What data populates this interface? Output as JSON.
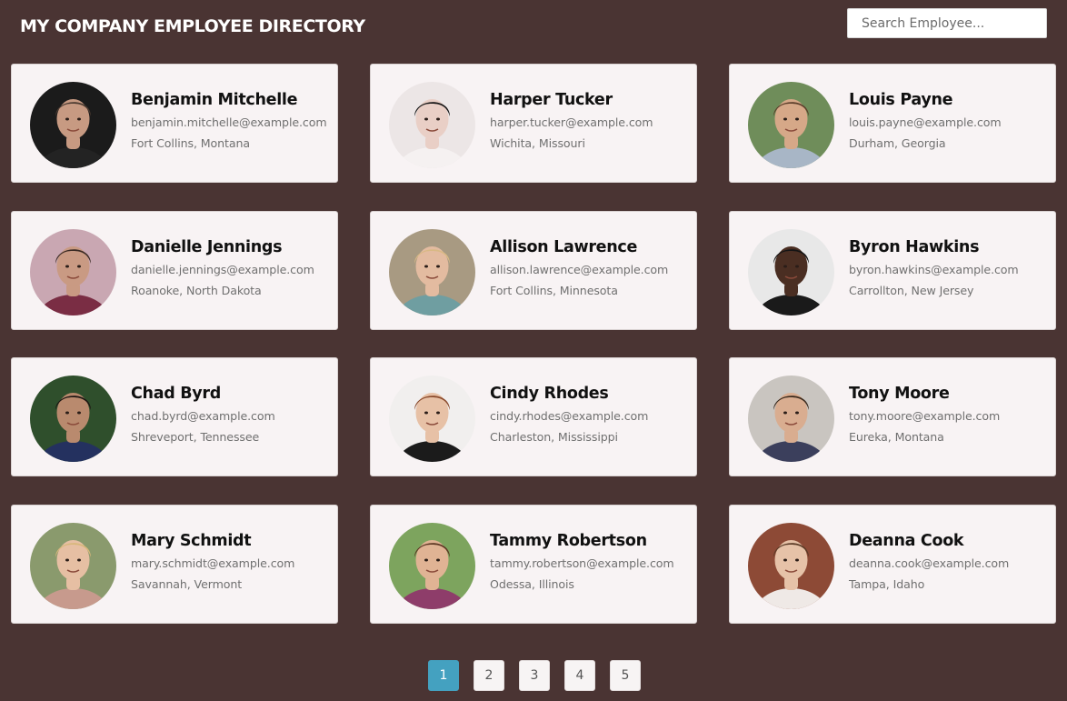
{
  "header": {
    "title": "MY COMPANY EMPLOYEE DIRECTORY",
    "search_placeholder": "Search Employee..."
  },
  "employees": [
    {
      "name": "Benjamin Mitchelle",
      "email": "benjamin.mitchelle@example.com",
      "location": "Fort Collins, Montana",
      "avatar": "portrait-man-dark-bg"
    },
    {
      "name": "Harper Tucker",
      "email": "harper.tucker@example.com",
      "location": "Wichita, Missouri",
      "avatar": "portrait-woman-light-bg"
    },
    {
      "name": "Louis Payne",
      "email": "louis.payne@example.com",
      "location": "Durham, Georgia",
      "avatar": "portrait-man-outdoor"
    },
    {
      "name": "Danielle Jennings",
      "email": "danielle.jennings@example.com",
      "location": "Roanoke, North Dakota",
      "avatar": "portrait-woman-scarf"
    },
    {
      "name": "Allison Lawrence",
      "email": "allison.lawrence@example.com",
      "location": "Fort Collins, Minnesota",
      "avatar": "portrait-woman-blonde"
    },
    {
      "name": "Byron Hawkins",
      "email": "byron.hawkins@example.com",
      "location": "Carrollton, New Jersey",
      "avatar": "portrait-man-glasses"
    },
    {
      "name": "Chad Byrd",
      "email": "chad.byrd@example.com",
      "location": "Shreveport, Tennessee",
      "avatar": "portrait-man-selfie"
    },
    {
      "name": "Cindy Rhodes",
      "email": "cindy.rhodes@example.com",
      "location": "Charleston, Mississippi",
      "avatar": "portrait-woman-redhead"
    },
    {
      "name": "Tony Moore",
      "email": "tony.moore@example.com",
      "location": "Eureka, Montana",
      "avatar": "portrait-man-plaid"
    },
    {
      "name": "Mary Schmidt",
      "email": "mary.schmidt@example.com",
      "location": "Savannah, Vermont",
      "avatar": "portrait-woman-blonde-curly"
    },
    {
      "name": "Tammy Robertson",
      "email": "tammy.robertson@example.com",
      "location": "Odessa, Illinois",
      "avatar": "portrait-woman-brunette"
    },
    {
      "name": "Deanna Cook",
      "email": "deanna.cook@example.com",
      "location": "Tampa, Idaho",
      "avatar": "portrait-woman-brick-wall"
    }
  ],
  "pagination": {
    "pages": [
      "1",
      "2",
      "3",
      "4",
      "5"
    ],
    "current": "1"
  },
  "colors": {
    "background": "#4a3433",
    "card": "#f8f3f4",
    "accent": "#44a1c0"
  }
}
